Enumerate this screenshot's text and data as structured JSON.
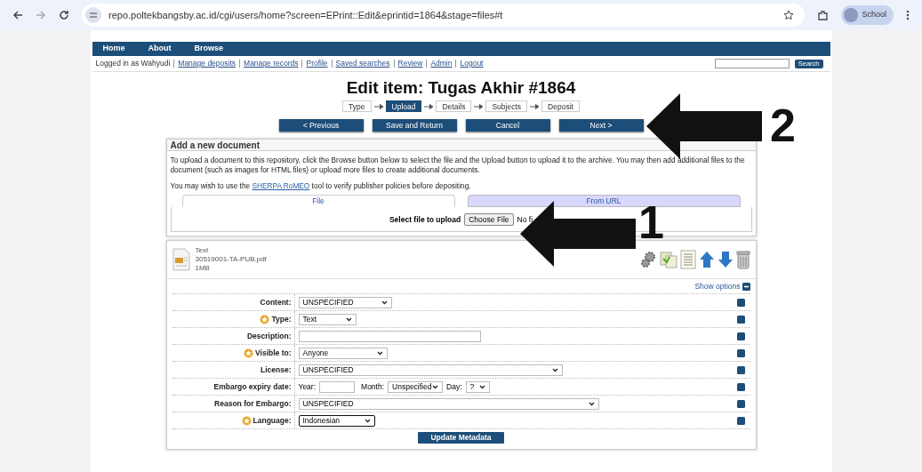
{
  "browser": {
    "url": "repo.poltekbangsby.ac.id/cgi/users/home?screen=EPrint::Edit&eprintid=1864&stage=files#t",
    "profile": "School"
  },
  "nav": [
    "Home",
    "About",
    "Browse"
  ],
  "user_bar": {
    "logged_in": "Logged in as Wahyudi",
    "links": [
      "Manage deposits",
      "Manage records",
      "Profile",
      "Saved searches",
      "Review",
      "Admin",
      "Logout"
    ],
    "search_button": "Search"
  },
  "title": "Edit item: Tugas Akhir #1864",
  "stages": [
    {
      "label": "Type",
      "selected": false
    },
    {
      "label": "Upload",
      "selected": true
    },
    {
      "label": "Details",
      "selected": false
    },
    {
      "label": "Subjects",
      "selected": false
    },
    {
      "label": "Deposit",
      "selected": false
    }
  ],
  "actions": [
    "< Previous",
    "Save and Return",
    "Cancel",
    "Next >"
  ],
  "add_document": {
    "heading": "Add a new document",
    "intro": "To upload a document to this repository, click the Browse button below to select the file and the Upload button to upload it to the archive. You may then add additional files to the document (such as images for HTML files) or upload more files to create additional documents.",
    "romeo_before": "You may wish to use the",
    "romeo_link": "SHERPA RoMEO",
    "romeo_after": "tool to verify publisher policies before depositing.",
    "tabs": [
      {
        "label": "File",
        "selected": true
      },
      {
        "label": "From URL",
        "selected": false
      }
    ],
    "upload_label": "Select file to upload",
    "choose_button": "Choose File",
    "no_file": "No fi"
  },
  "document": {
    "type": "Text",
    "filename": "30519001-TA-PUB.pdf",
    "size": "1MB",
    "show_options": "Show options",
    "fields": [
      {
        "label": "Content:",
        "kind": "select",
        "required": false,
        "value": "UNSPECIFIED"
      },
      {
        "label": "Type:",
        "kind": "select",
        "required": true,
        "value": "Text"
      },
      {
        "label": "Description:",
        "kind": "input",
        "required": false
      },
      {
        "label": "Visible to:",
        "kind": "select",
        "required": true,
        "value": "Anyone"
      },
      {
        "label": "License:",
        "kind": "select",
        "required": false,
        "value": "UNSPECIFIED"
      },
      {
        "label": "Embargo expiry date:",
        "kind": "date",
        "required": false,
        "year_label": "Year:",
        "month_label": "Month:",
        "month": "Unspecified",
        "day_label": "Day:",
        "day": "?"
      },
      {
        "label": "Reason for Embargo:",
        "kind": "select",
        "required": false,
        "value": "UNSPECIFIED"
      },
      {
        "label": "Language:",
        "kind": "select",
        "required": true,
        "value": "Indonesian",
        "focused": true
      }
    ],
    "update_button": "Update Metadata"
  },
  "annotations": [
    {
      "label": "2"
    },
    {
      "label": "1"
    }
  ]
}
